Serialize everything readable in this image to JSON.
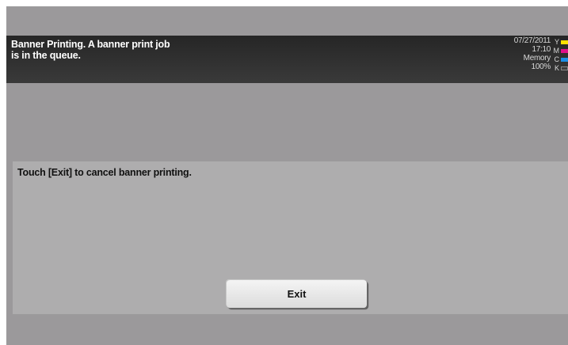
{
  "header": {
    "message_line1": "Banner Printing. A banner print job",
    "message_line2": "is in the queue.",
    "date": "07/27/2011",
    "time": "17:10",
    "memory_label": "Memory",
    "memory_value": "100%"
  },
  "toner": [
    {
      "letter": "Y",
      "color": "#ffe000"
    },
    {
      "letter": "M",
      "color": "#e0108a"
    },
    {
      "letter": "C",
      "color": "#1a8ee6"
    },
    {
      "letter": "K",
      "color": "#3c3c3c"
    }
  ],
  "panel": {
    "instruction": "Touch [Exit] to cancel banner printing.",
    "exit_label": "Exit"
  }
}
